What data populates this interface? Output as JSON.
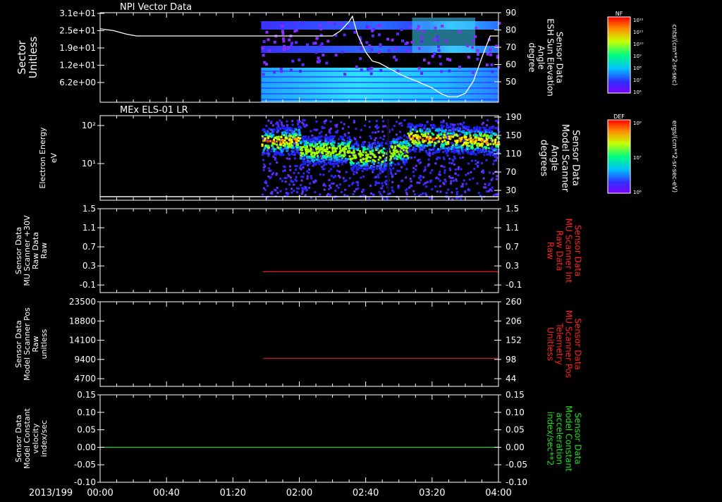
{
  "date_label": "2013/199",
  "time_ticks": [
    "00:00",
    "00:40",
    "01:20",
    "02:00",
    "02:40",
    "03:20",
    "04:00"
  ],
  "chart_data": [
    {
      "type": "heatmap",
      "title": "NPI Vector Data",
      "ylabel": [
        "Sector",
        "Unitless"
      ],
      "yticks": [
        "3.1e+01",
        "2.5e+01",
        "1.9e+01",
        "1.2e+01",
        "6.2e+00"
      ],
      "x_range": [
        "00:00",
        "04:00"
      ],
      "data_start": "01:37",
      "y2label": [
        "Sensor Data",
        "ESH Sun Elevation",
        "Angle",
        "degree"
      ],
      "y2ticks": [
        "90",
        "80",
        "70",
        "60",
        "50"
      ],
      "y2lim": [
        40,
        90
      ],
      "overlay_line": {
        "color": "#ffffff",
        "x_minutes": [
          0,
          8,
          16,
          22,
          60,
          100,
          140,
          145,
          150,
          152,
          155,
          160,
          164,
          168,
          172,
          176,
          182,
          190,
          200,
          205,
          210,
          215,
          220,
          225,
          230,
          235,
          240
        ],
        "y_degrees": [
          81,
          80,
          78,
          77,
          77,
          77,
          77,
          80,
          85,
          88,
          78,
          68,
          63,
          62,
          60,
          58,
          55,
          52,
          48,
          45,
          43,
          43,
          45,
          52,
          65,
          77,
          77
        ]
      },
      "colorbar": {
        "label": "cnts/(cm**2-sr-sec)",
        "tag": "NF",
        "ticks": [
          "10¹²",
          "10¹¹",
          "10¹⁰",
          "10⁹",
          "10⁸",
          "10⁷",
          "10⁶"
        ]
      }
    },
    {
      "type": "heatmap",
      "title": "MEx ELS-01 LR",
      "ylabel": [
        "Electron Energy",
        "eV"
      ],
      "yticks": [
        "10²",
        "10¹"
      ],
      "data_start": "01:37",
      "y2label": [
        "Sensor Data",
        "Model Scanner",
        "Angle",
        "degrees"
      ],
      "y2ticks": [
        "190",
        "150",
        "110",
        "70",
        "30"
      ],
      "y2lim": [
        0,
        190
      ],
      "overlay_line": {
        "color": "#ffffff",
        "y_degrees": 8
      },
      "colorbar": {
        "label": "ergs/(cm**2-sr-sec-eV)",
        "tag": "DEF",
        "ticks": [
          "10⁸",
          "10⁷",
          "10⁶"
        ]
      }
    },
    {
      "type": "line",
      "ylabel": [
        "Sensor Data",
        "MU Scanner +30V",
        "Raw Data",
        "Raw"
      ],
      "yticks": [
        "1.5",
        "1.1",
        "0.7",
        "0.3",
        "-0.1"
      ],
      "ylim": [
        -0.5,
        1.5
      ],
      "y2label": [
        "Sensor Data",
        "MU Scanner Int",
        "Raw Data",
        "Raw"
      ],
      "y2ticks": [
        "1.5",
        "1.1",
        "0.7",
        "0.3",
        "-0.1"
      ],
      "series": [
        {
          "color": "#e02020",
          "x_start_minutes": 98,
          "x_end_minutes": 240,
          "value": 0.0
        }
      ]
    },
    {
      "type": "line",
      "ylabel": [
        "Sensor Data",
        "Model Scanner Pos",
        "Raw",
        "unitless"
      ],
      "yticks": [
        "23500",
        "18800",
        "14100",
        "9400",
        "4700"
      ],
      "ylim": [
        0,
        23500
      ],
      "y2label": [
        "Sensor Data",
        "MU Scanner Pos",
        "Telemetry",
        "Unitless"
      ],
      "y2ticks": [
        "260",
        "206",
        "152",
        "98",
        "44"
      ],
      "series": [
        {
          "color": "#e02020",
          "x_start_minutes": 98,
          "x_end_minutes": 240,
          "value": 7800
        }
      ]
    },
    {
      "type": "line",
      "ylabel": [
        "Sensor Data",
        "Model Constant",
        "velocity",
        "index/sec"
      ],
      "yticks": [
        "0.15",
        "0.10",
        "0.05",
        "0.00",
        "-0.05",
        "-0.10"
      ],
      "ylim": [
        -0.1,
        0.15
      ],
      "y2label": [
        "Sensor Data",
        "Model Constant",
        "acceleration",
        "index/sec**2"
      ],
      "y2ticks": [
        "0.15",
        "0.10",
        "0.05",
        "0.00",
        "-0.05",
        "-0.10"
      ],
      "series": [
        {
          "color": "#20d020",
          "x_start_minutes": 0,
          "x_end_minutes": 240,
          "value": 0.0
        }
      ]
    }
  ],
  "colors": {
    "axis": "#ffffff",
    "background": "#000000",
    "red_label": "#ff2020",
    "green_label": "#20e020"
  }
}
